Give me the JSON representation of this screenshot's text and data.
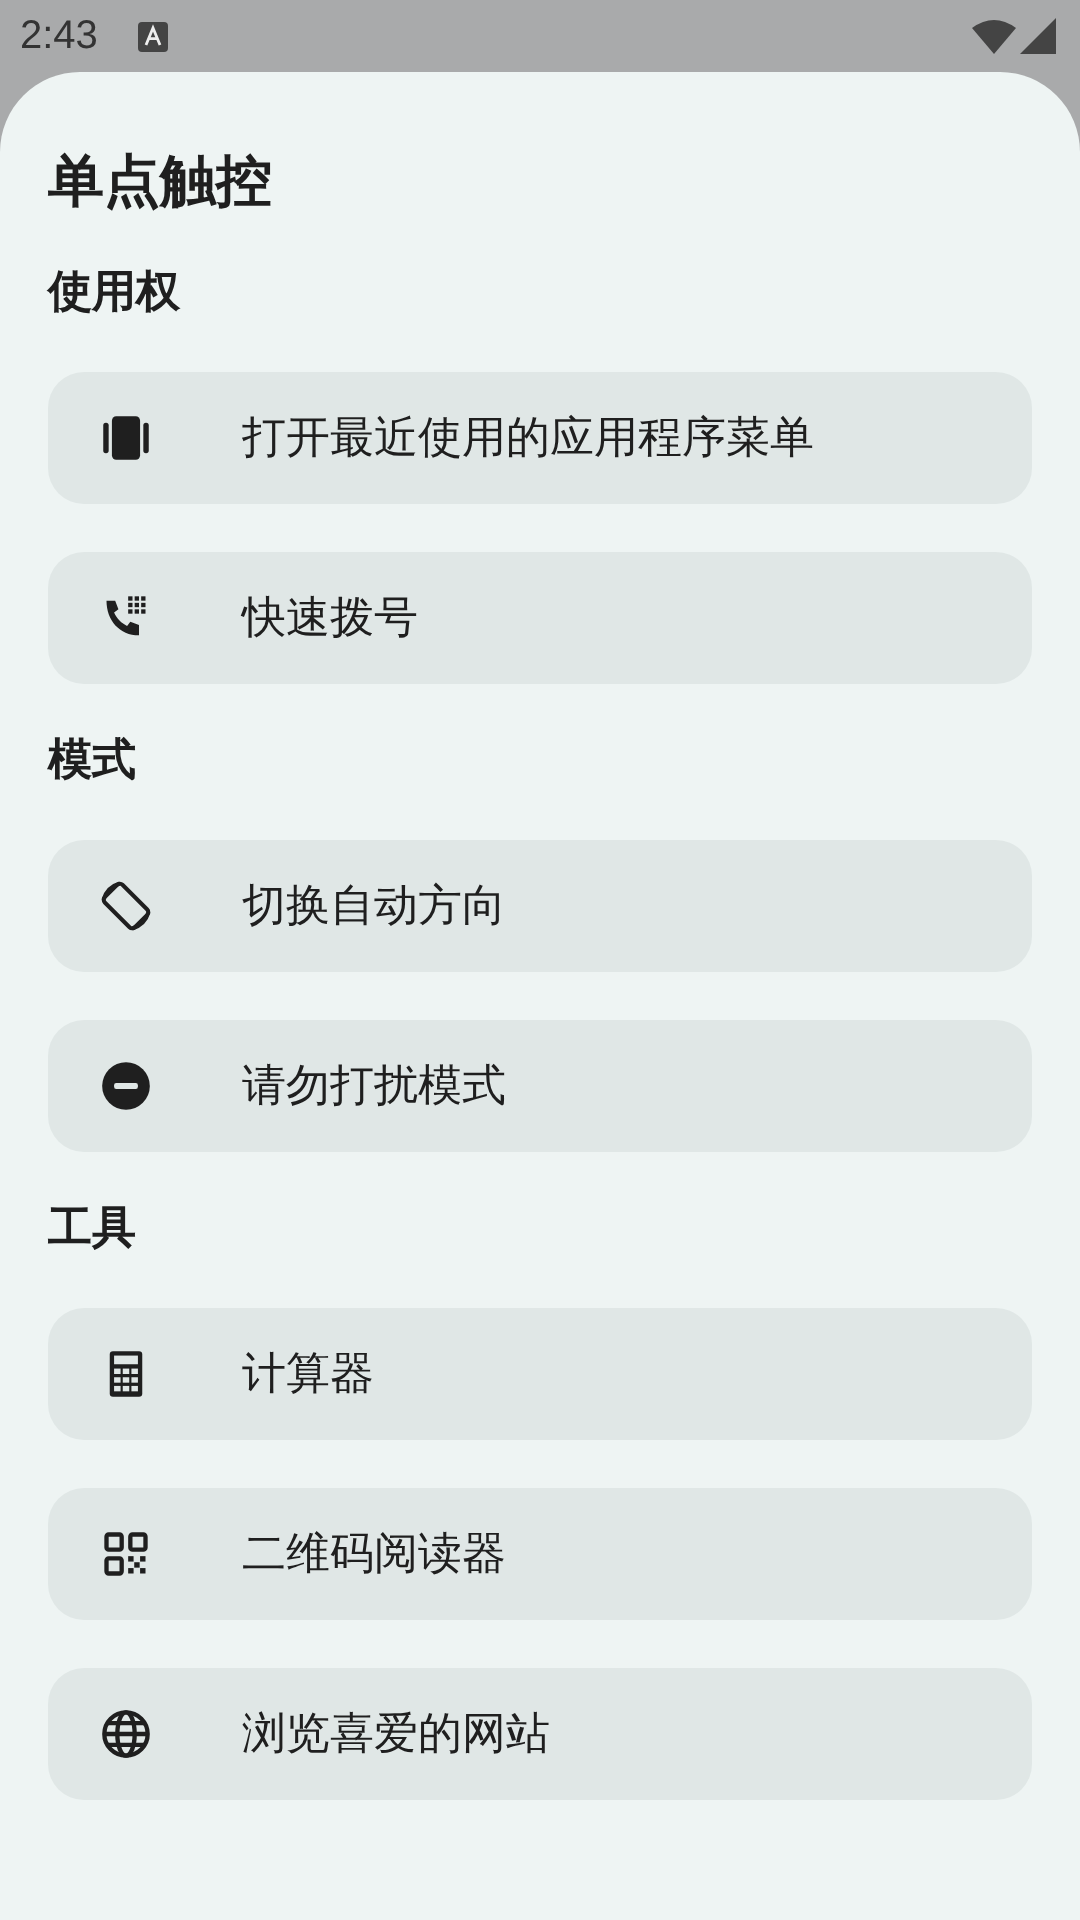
{
  "status_bar": {
    "time": "2:43"
  },
  "title": "单点触控",
  "sections": [
    {
      "header": "使用权",
      "items": [
        {
          "label": "打开最近使用的应用程序菜单"
        },
        {
          "label": "快速拨号"
        }
      ]
    },
    {
      "header": "模式",
      "items": [
        {
          "label": "切换自动方向"
        },
        {
          "label": "请勿打扰模式"
        }
      ]
    },
    {
      "header": "工具",
      "items": [
        {
          "label": "计算器"
        },
        {
          "label": "二维码阅读器"
        },
        {
          "label": "浏览喜爱的网站"
        }
      ]
    }
  ]
}
